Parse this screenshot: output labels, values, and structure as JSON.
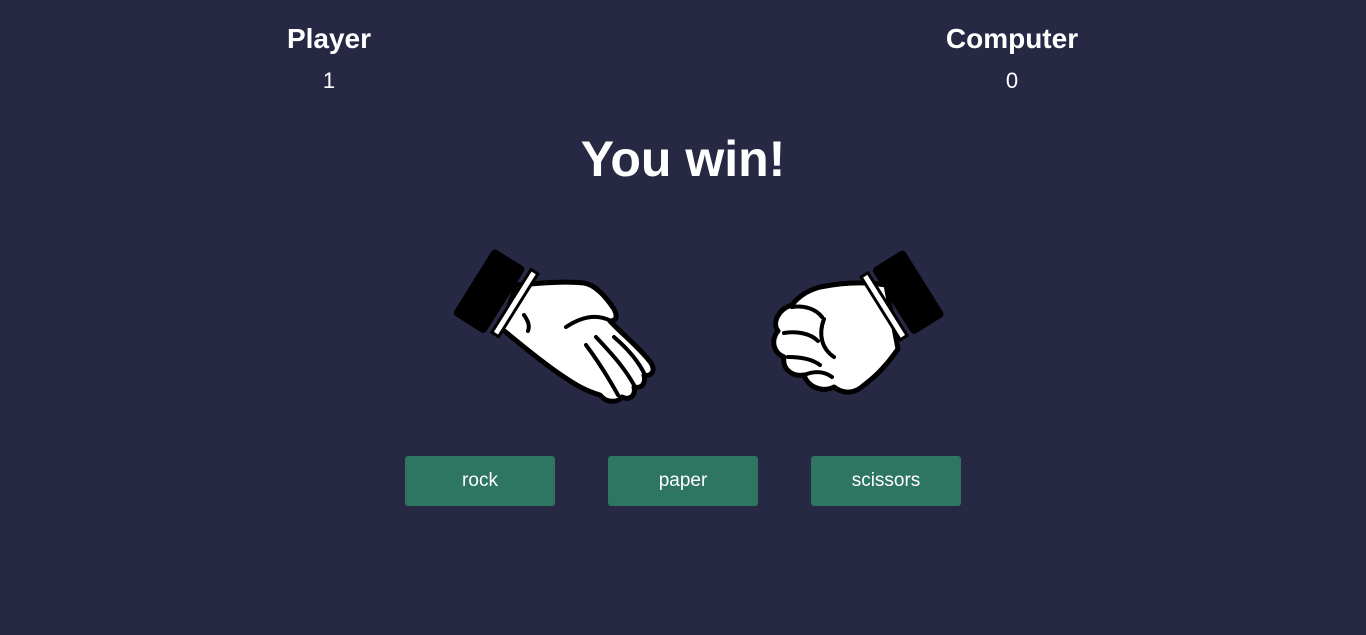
{
  "scoreboard": {
    "player": {
      "label": "Player",
      "score": "1"
    },
    "computer": {
      "label": "Computer",
      "score": "0"
    }
  },
  "result": {
    "message": "You win!"
  },
  "hands": {
    "player": {
      "choice": "paper",
      "icon": "open-hand-icon"
    },
    "computer": {
      "choice": "rock",
      "icon": "fist-icon"
    }
  },
  "choices": [
    {
      "label": "rock"
    },
    {
      "label": "paper"
    },
    {
      "label": "scissors"
    }
  ],
  "colors": {
    "background": "#272844",
    "button": "#2e7562",
    "text": "#ffffff"
  }
}
